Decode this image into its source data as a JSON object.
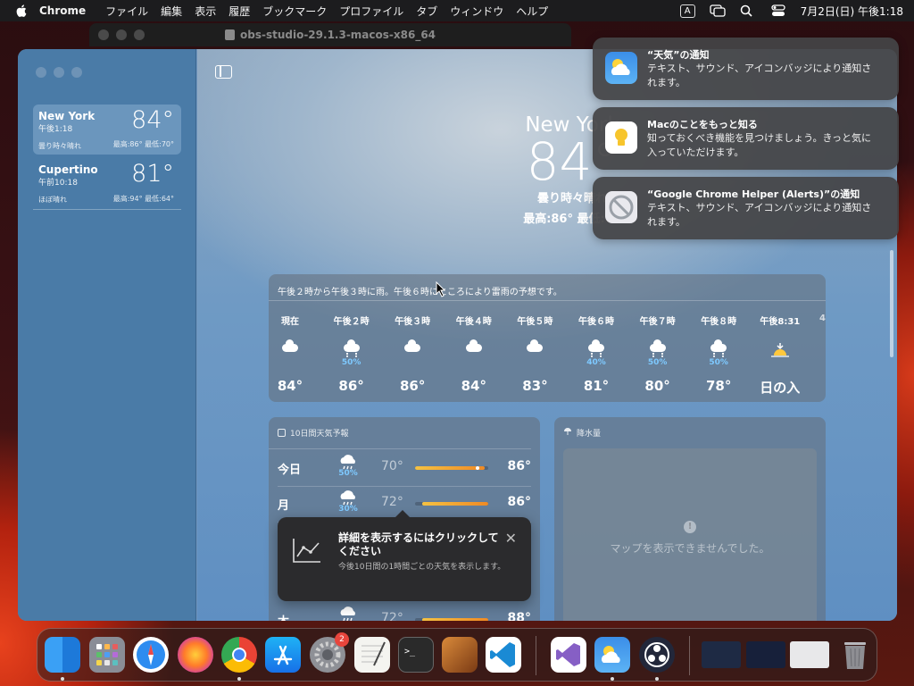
{
  "menubar": {
    "apple": "",
    "app": "Chrome",
    "items": [
      "ファイル",
      "編集",
      "表示",
      "履歴",
      "ブックマーク",
      "プロファイル",
      "タブ",
      "ウィンドウ",
      "ヘルプ"
    ],
    "input_indicator": "A",
    "datetime": "7月2日(日) 午後1:18"
  },
  "obs_window": {
    "title": "obs-studio-29.1.3-macos-x86_64"
  },
  "sidebar": {
    "cities": [
      {
        "name": "New York",
        "time": "午後1:18",
        "temp": "84°",
        "condition": "曇り時々晴れ",
        "hilo": "最高:86° 最低:70°"
      },
      {
        "name": "Cupertino",
        "time": "午前10:18",
        "temp": "81°",
        "condition": "ほぼ晴れ",
        "hilo": "最高:94° 最低:64°"
      }
    ]
  },
  "hero": {
    "city": "New York",
    "temp": "84°",
    "condition": "曇り時々晴れ",
    "hilo": "最高:86° 最低:70"
  },
  "hourly": {
    "summary": "午後２時から午後３時に雨。午後６時にところにより雷雨の予想です。",
    "hours": [
      {
        "label": "現在",
        "icon": "cloud-icon",
        "pct": "",
        "temp": "84°"
      },
      {
        "label": "午後２時",
        "icon": "cloud-rain-icon",
        "pct": "50%",
        "temp": "86°"
      },
      {
        "label": "午後３時",
        "icon": "cloud-icon",
        "pct": "",
        "temp": "86°"
      },
      {
        "label": "午後４時",
        "icon": "cloud-icon",
        "pct": "",
        "temp": "84°"
      },
      {
        "label": "午後５時",
        "icon": "cloud-icon",
        "pct": "",
        "temp": "83°"
      },
      {
        "label": "午後６時",
        "icon": "cloud-rain-icon",
        "pct": "40%",
        "temp": "81°"
      },
      {
        "label": "午後７時",
        "icon": "cloud-rain-icon",
        "pct": "50%",
        "temp": "80°"
      },
      {
        "label": "午後８時",
        "icon": "cloud-rain-icon",
        "pct": "50%",
        "temp": "78°"
      },
      {
        "label": "午後8:31",
        "icon": "sunset-icon",
        "pct": "",
        "temp": "日の入"
      }
    ]
  },
  "tenday": {
    "header": "10日間天気予報",
    "days": [
      {
        "day": "今日",
        "pct": "50%",
        "lo": "70°",
        "hi": "86°",
        "bar_start": 0.0,
        "bar_end": 0.95,
        "dot": 0.85
      },
      {
        "day": "月",
        "pct": "30%",
        "lo": "72°",
        "hi": "86°",
        "bar_start": 0.1,
        "bar_end": 1.0
      },
      {
        "day": "木",
        "pct": "",
        "lo": "72°",
        "hi": "88°",
        "bar_start": 0.1,
        "bar_end": 1.0
      }
    ]
  },
  "precip": {
    "header": "降水量",
    "message": "マップを表示できませんでした。"
  },
  "popover": {
    "title": "詳細を表示するにはクリックしてください",
    "subtitle": "今後10日間の1時間ごとの天気を表示します。"
  },
  "notifications": [
    {
      "title": "“天気”の通知",
      "body": "テキスト、サウンド、アイコンバッジにより通知されます。",
      "icon": "weather-app-icon"
    },
    {
      "title": "Macのことをもっと知る",
      "body": "知っておくべき機能を見つけましょう。きっと気に入っていただけます。",
      "icon": "tips-app-icon"
    },
    {
      "title": "“Google Chrome Helper (Alerts)”の通知",
      "body": "テキスト、サウンド、アイコンバッジにより通知されます。",
      "icon": "blocked-app-icon"
    }
  ],
  "dock": {
    "apps": [
      "Finder",
      "Launchpad",
      "Safari",
      "Firefox",
      "Chrome",
      "App Store",
      "システム設定",
      "テキストエディット",
      "ターミナル",
      "Instruments",
      "Visual Studio Code",
      "Visual Studio",
      "天気",
      "OBS"
    ],
    "settings_badge": "2"
  }
}
